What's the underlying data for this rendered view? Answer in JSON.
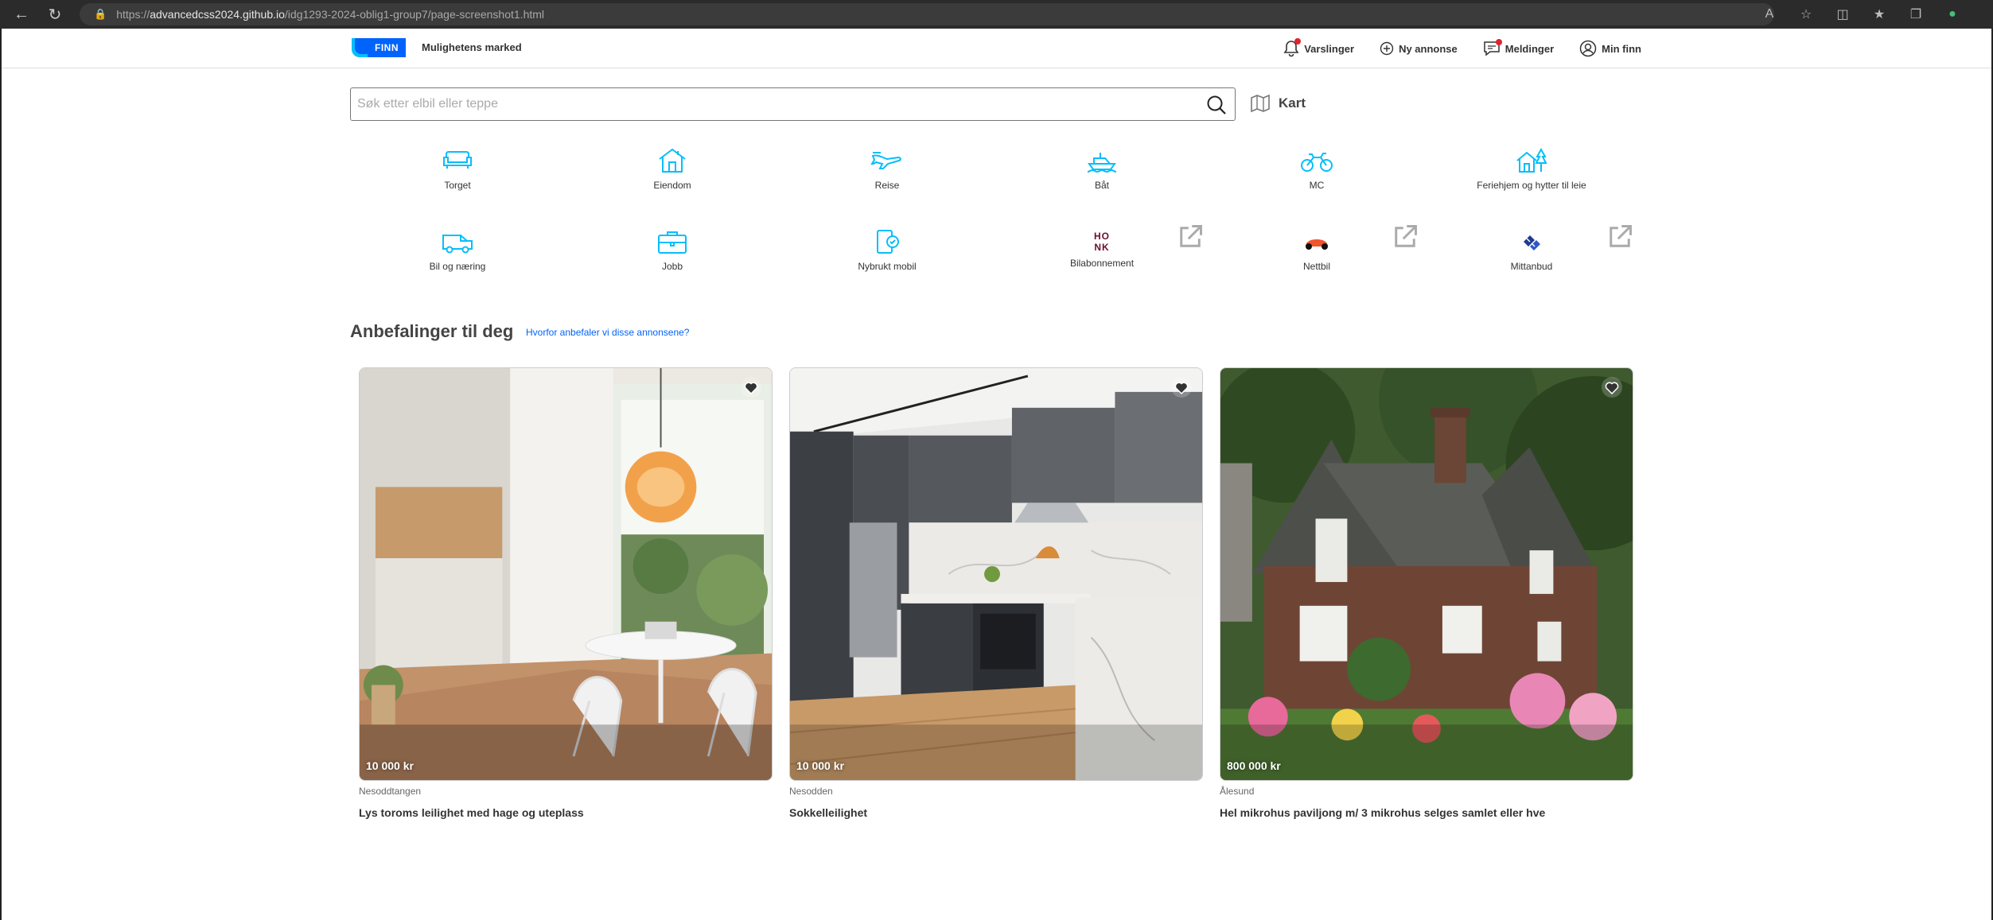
{
  "browser": {
    "url_prefix": "https://",
    "url_host": "advancedcss2024.github.io",
    "url_path": "/idg1293-2024-oblig1-group7/page-screenshot1.html"
  },
  "header": {
    "logo_text": "FINN",
    "tagline": "Mulighetens marked",
    "nav": [
      {
        "label": "Varslinger",
        "icon": "bell-icon",
        "notification": true
      },
      {
        "label": "Ny annonse",
        "icon": "plus-circle-icon",
        "notification": false
      },
      {
        "label": "Meldinger",
        "icon": "chat-icon",
        "notification": true
      },
      {
        "label": "Min finn",
        "icon": "user-circle-icon",
        "notification": false
      }
    ]
  },
  "search": {
    "placeholder": "Søk etter elbil eller teppe",
    "value": "",
    "map_label": "Kart"
  },
  "categories": [
    {
      "label": "Torget",
      "icon": "sofa-icon",
      "external": false
    },
    {
      "label": "Eiendom",
      "icon": "house-icon",
      "external": false
    },
    {
      "label": "Reise",
      "icon": "plane-icon",
      "external": false
    },
    {
      "label": "Båt",
      "icon": "boat-icon",
      "external": false
    },
    {
      "label": "MC",
      "icon": "motorcycle-icon",
      "external": false
    },
    {
      "label": "Feriehjem og hytter til leie",
      "icon": "cabin-icon",
      "external": false
    },
    {
      "label": "Bil og næring",
      "icon": "van-icon",
      "external": false
    },
    {
      "label": "Jobb",
      "icon": "briefcase-icon",
      "external": false
    },
    {
      "label": "Nybrukt mobil",
      "icon": "phone-icon",
      "external": false
    },
    {
      "label": "Bilabonnement",
      "icon": "honk-logo-icon",
      "external": true
    },
    {
      "label": "Nettbil",
      "icon": "nettbil-logo-icon",
      "external": true
    },
    {
      "label": "Mittanbud",
      "icon": "mittanbud-logo-icon",
      "external": true
    }
  ],
  "honk_logo_text": "HONK",
  "recommendations": {
    "title": "Anbefalinger til deg",
    "link": "Hvorfor anbefaler vi disse annonsene?",
    "items": [
      {
        "price": "10 000 kr",
        "location": "Nesoddtangen",
        "title": "Lys toroms leilighet med hage og uteplass"
      },
      {
        "price": "10 000 kr",
        "location": "Nesodden",
        "title": "Sokkelleilighet"
      },
      {
        "price": "800 000 kr",
        "location": "Ålesund",
        "title": "Hel mikrohus paviljong m/ 3 mikrohus selges samlet eller hve"
      }
    ]
  },
  "colors": {
    "brand": "#0063fb",
    "brand_light": "#06befb",
    "accent": "#e0242f"
  }
}
